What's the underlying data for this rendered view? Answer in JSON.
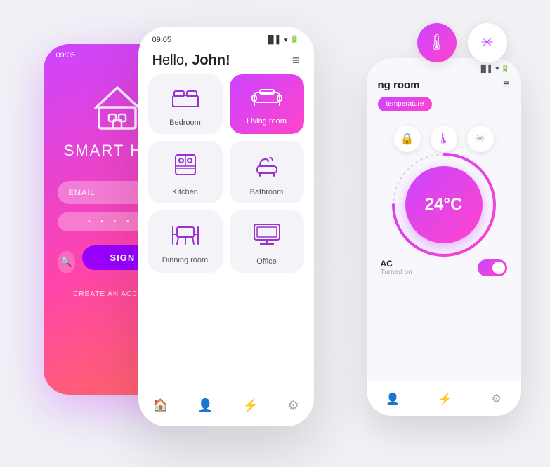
{
  "left_phone": {
    "status_time": "09:05",
    "app_title_prefix": "SMART ",
    "app_title_bold": "HOM",
    "email_placeholder": "EMAIL",
    "password_dots": "• • • • •",
    "signin_label": "SIGN IN",
    "create_account_label": "CREATE AN ACCOUNT"
  },
  "center_phone": {
    "status_time": "09:05",
    "greeting_prefix": "Hello, ",
    "greeting_name": "John!",
    "hamburger": "≡",
    "rooms": [
      {
        "id": "bedroom",
        "label": "Bedroom",
        "icon": "🛏",
        "active": false
      },
      {
        "id": "living-room",
        "label": "Living room",
        "icon": "🛋",
        "active": true
      },
      {
        "id": "kitchen",
        "label": "Kitchen",
        "icon": "🍳",
        "active": false
      },
      {
        "id": "bathroom",
        "label": "Bathroom",
        "icon": "🛁",
        "active": false
      },
      {
        "id": "dinning-room",
        "label": "Dinning room",
        "icon": "🪑",
        "active": false
      },
      {
        "id": "office",
        "label": "Office",
        "icon": "🖥",
        "active": false
      }
    ],
    "nav_items": [
      "🏠",
      "👤",
      "⚡",
      "⚙"
    ]
  },
  "right_phone": {
    "room_name": "ng room",
    "room_name_full": "Living room",
    "tab_label": "temperature",
    "temperature": "24°C",
    "ac_label": "AC",
    "ac_sublabel": "Turned on"
  },
  "floating": {
    "thermometer_icon": "🌡",
    "fan_icon": "✳"
  }
}
